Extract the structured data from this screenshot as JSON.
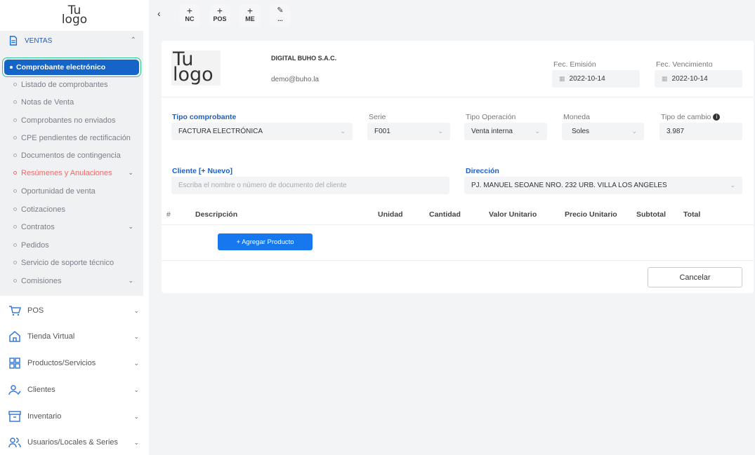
{
  "sidebar": {
    "logo_line1": "Tu",
    "logo_line2": "logo",
    "ventas_label": "VENTAS",
    "active_item": "Comprobante electrónico",
    "sub_items": [
      "Listado de comprobantes",
      "Notas de Venta",
      "Comprobantes no enviados",
      "CPE pendientes de rectificación",
      "Documentos de contingencia",
      "Resúmenes y Anulaciones",
      "Oportunidad de venta",
      "Cotizaciones",
      "Contratos",
      "Pedidos",
      "Servicio de soporte técnico",
      "Comisiones"
    ],
    "menu": [
      "POS",
      "Tienda Virtual",
      "Productos/Servicios",
      "Clientes",
      "Inventario",
      "Usuarios/Locales & Series"
    ]
  },
  "toolbar": {
    "nc": "NC",
    "pos": "POS",
    "me": "ME",
    "more": "..."
  },
  "form": {
    "logo_line1": "Tu",
    "logo_line2": "logo",
    "company": "DIGITAL BUHO S.A.C.",
    "email": "demo@buho.la",
    "fec_emision_label": "Fec. Emisión",
    "fec_emision": "2022-10-14",
    "fec_venc_label": "Fec. Vencimiento",
    "fec_venc": "2022-10-14",
    "tipo_comprobante_label": "Tipo comprobante",
    "tipo_comprobante": "FACTURA ELECTRÓNICA",
    "serie_label": "Serie",
    "serie": "F001",
    "tipo_operacion_label": "Tipo Operación",
    "tipo_operacion": "Venta interna",
    "moneda_label": "Moneda",
    "moneda": "Soles",
    "tipo_cambio_label": "Tipo de cambio",
    "tipo_cambio": "3.987",
    "cliente_label": "Cliente [+ Nuevo]",
    "cliente_placeholder": "Escriba el nombre o número de documento del cliente",
    "direccion_label": "Dirección",
    "direccion": "PJ. MANUEL SEOANE NRO. 232 URB. VILLA LOS ANGELES",
    "table_headers": [
      "#",
      "Descripción",
      "Unidad",
      "Cantidad",
      "Valor Unitario",
      "Precio Unitario",
      "Subtotal",
      "Total"
    ],
    "add_product": "+ Agregar Producto",
    "cancel": "Cancelar"
  },
  "colors": {
    "primary": "#1565c8",
    "button": "#1677ef",
    "active_outline": "#2dc597",
    "label_blue": "#1a5fc7"
  }
}
